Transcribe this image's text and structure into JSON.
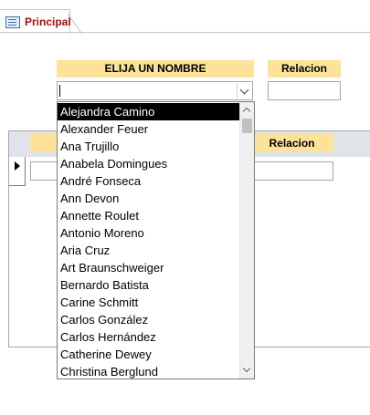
{
  "tab": {
    "label": "Principal",
    "icon": "form-icon"
  },
  "form": {
    "name_header": "ELIJA UN NOMBRE",
    "relation_header": "Relacion",
    "name_value": "",
    "relation_value": ""
  },
  "subform": {
    "relation_header": "Relacion"
  },
  "dropdown": {
    "items": [
      "Alejandra Camino",
      "Alexander Feuer",
      "Ana Trujillo",
      "Anabela Domingues",
      "André Fonseca",
      "Ann Devon",
      "Annette Roulet",
      "Antonio Moreno",
      "Aria Cruz",
      "Art Braunschweiger",
      "Bernardo Batista",
      "Carine Schmitt",
      "Carlos González",
      "Carlos Hernández",
      "Catherine Dewey",
      "Christina Berglund"
    ],
    "selected_index": 0
  },
  "colors": {
    "header_fill": "#fde39a",
    "tab_text": "#a01010",
    "selection": "#000000"
  }
}
